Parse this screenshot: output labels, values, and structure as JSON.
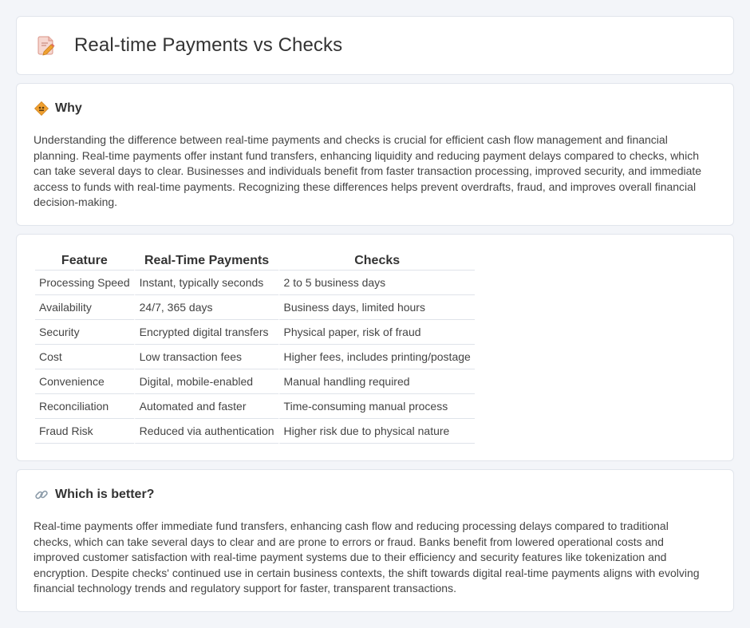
{
  "header": {
    "title": "Real-time Payments vs Checks",
    "icon": "document-pencil-icon"
  },
  "why": {
    "title": "Why",
    "icon": "diamond-sign-icon",
    "text": "Understanding the difference between real-time payments and checks is crucial for efficient cash flow management and financial planning. Real-time payments offer instant fund transfers, enhancing liquidity and reducing payment delays compared to checks, which can take several days to clear. Businesses and individuals benefit from faster transaction processing, improved security, and immediate access to funds with real-time payments. Recognizing these differences helps prevent overdrafts, fraud, and improves overall financial decision-making."
  },
  "table": {
    "headers": [
      "Feature",
      "Real-Time Payments",
      "Checks"
    ],
    "rows": [
      [
        "Processing Speed",
        "Instant, typically seconds",
        "2 to 5 business days"
      ],
      [
        "Availability",
        "24/7, 365 days",
        "Business days, limited hours"
      ],
      [
        "Security",
        "Encrypted digital transfers",
        "Physical paper, risk of fraud"
      ],
      [
        "Cost",
        "Low transaction fees",
        "Higher fees, includes printing/postage"
      ],
      [
        "Convenience",
        "Digital, mobile-enabled",
        "Manual handling required"
      ],
      [
        "Reconciliation",
        "Automated and faster",
        "Time-consuming manual process"
      ],
      [
        "Fraud Risk",
        "Reduced via authentication",
        "Higher risk due to physical nature"
      ]
    ]
  },
  "better": {
    "title": "Which is better?",
    "icon": "link-icon",
    "text": "Real-time payments offer immediate fund transfers, enhancing cash flow and reducing processing delays compared to traditional checks, which can take several days to clear and are prone to errors or fraud. Banks benefit from lowered operational costs and improved customer satisfaction with real-time payment systems due to their efficiency and security features like tokenization and encryption. Despite checks' continued use in certain business contexts, the shift towards digital real-time payments aligns with evolving financial technology trends and regulatory support for faster, transparent transactions."
  },
  "colors": {
    "background": "#f3f5f9",
    "card": "#ffffff",
    "accent_orange": "#f0a030",
    "icon_pink": "#e98b7b"
  }
}
